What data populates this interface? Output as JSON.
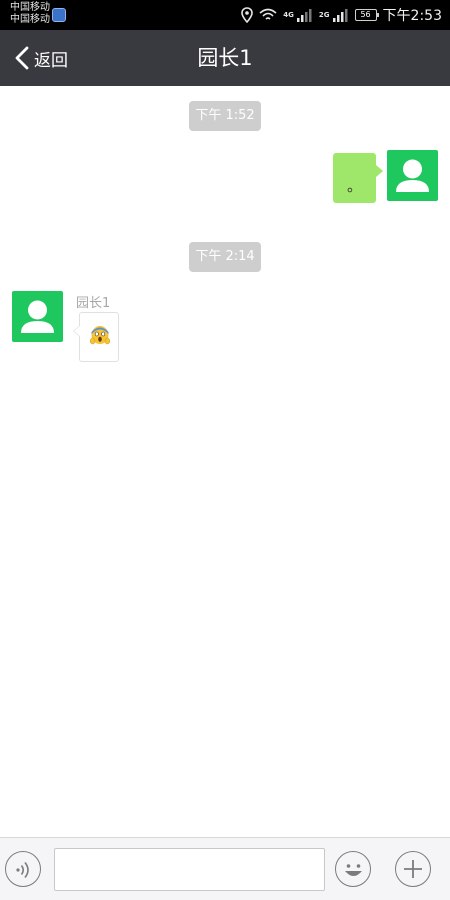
{
  "status_bar": {
    "carrier_1": "中国移动",
    "carrier_2": "中国移动",
    "network_1": "4G",
    "network_2": "2G",
    "battery": "56",
    "time": "下午2:53"
  },
  "header": {
    "back_label": "返回",
    "title": "园长1"
  },
  "messages": [
    {
      "type": "time",
      "text": "下午 1:52"
    },
    {
      "type": "outgoing",
      "text": "。"
    },
    {
      "type": "time",
      "text": "下午 2:14"
    },
    {
      "type": "incoming",
      "sender": "园长1",
      "content": "scream-emoji"
    }
  ],
  "input_bar": {
    "value": "",
    "placeholder": ""
  },
  "icons": {
    "back": "chevron-left-icon",
    "voice": "voice-icon",
    "emoji": "emoji-icon",
    "plus": "plus-icon",
    "avatar": "default-avatar-icon"
  },
  "colors": {
    "header_bg": "#393a3f",
    "avatar_bg": "#1ec85f",
    "outgoing_bubble": "#9fe76b",
    "time_chip": "#cecece"
  }
}
